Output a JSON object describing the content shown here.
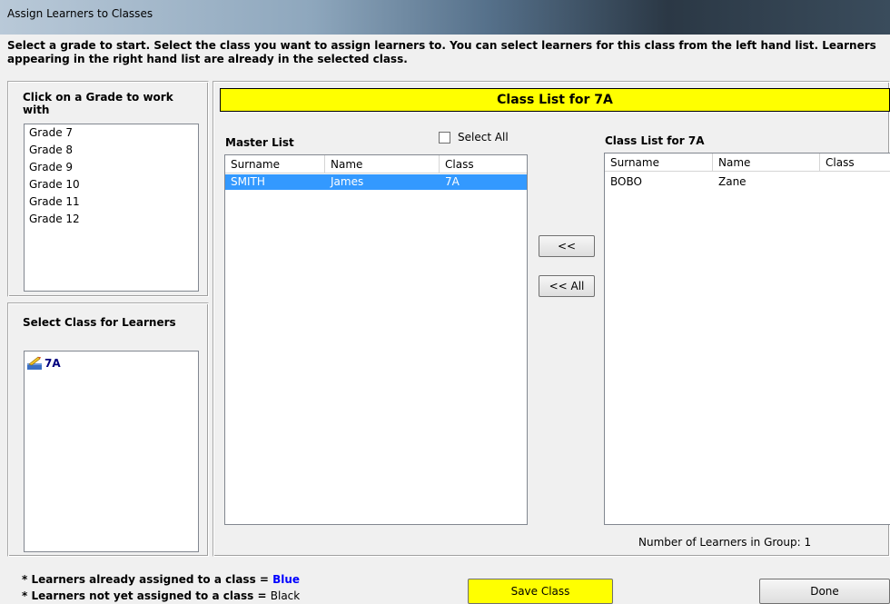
{
  "window": {
    "title": "Assign Learners to Classes"
  },
  "intro": "Select a grade to start. Select the class you want to assign learners to. You can select learners for this class from the left hand list. Learners appearing in the right hand list are already in the selected class.",
  "grade_panel": {
    "label": "Click on a Grade to work with",
    "grades": [
      "Grade 7",
      "Grade 8",
      "Grade 9",
      "Grade 10",
      "Grade 11",
      "Grade 12"
    ]
  },
  "class_panel": {
    "label": "Select Class for Learners",
    "classes": [
      {
        "name": "7A",
        "icon": "class-icon"
      }
    ]
  },
  "banner": "Class List for 7A",
  "master_list": {
    "label": "Master List",
    "select_all_label": "Select All",
    "columns": [
      "Surname",
      "Name",
      "Class"
    ],
    "rows": [
      {
        "surname": "SMITH",
        "name": "James",
        "class": "7A",
        "selected": true
      }
    ]
  },
  "class_list": {
    "label": "Class List for 7A",
    "columns": [
      "Surname",
      "Name",
      "Class"
    ],
    "rows": [
      {
        "surname": "BOBO",
        "name": "Zane",
        "class": ""
      }
    ],
    "count_text": "Number of Learners in Group: 1"
  },
  "buttons": {
    "move_left": "<<",
    "move_all_left": "<< All",
    "save_class": "Save Class",
    "done": "Done"
  },
  "legend": {
    "assigned_prefix": "* Learners already assigned to a class = ",
    "assigned_color_word": "Blue",
    "unassigned_prefix": "* Learners not yet assigned to a class = ",
    "unassigned_color_word": "Black"
  },
  "colors": {
    "banner": "#ffff00",
    "selection": "#3399ff",
    "assigned": "#0000ff"
  }
}
